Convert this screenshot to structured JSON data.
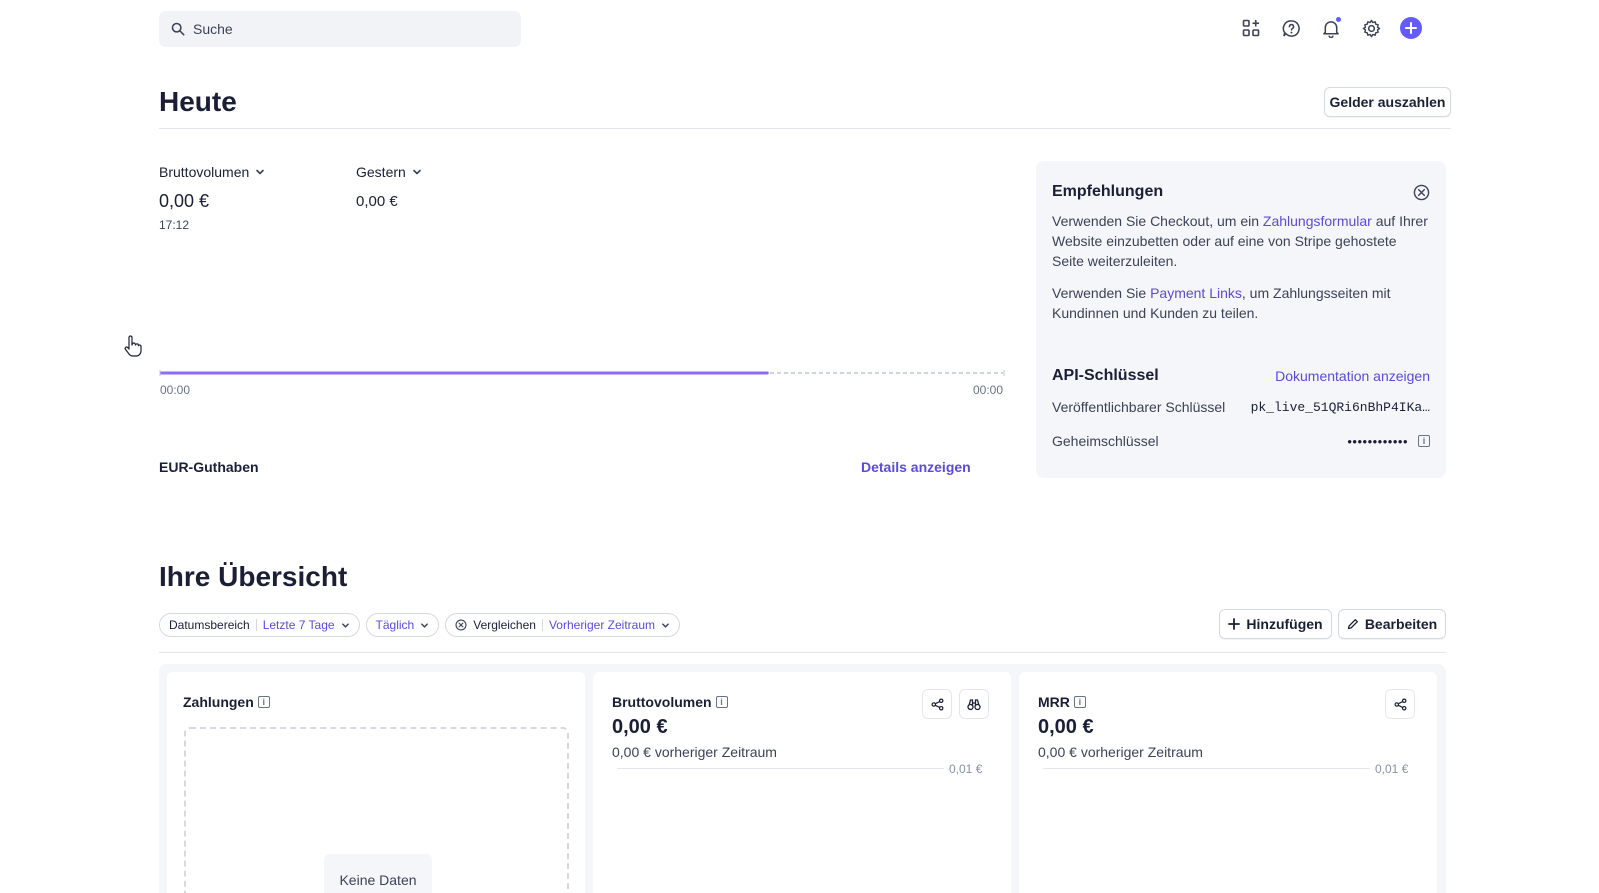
{
  "search": {
    "placeholder": "Suche"
  },
  "topbar": {
    "icons": [
      "apps-icon",
      "help-icon",
      "bell-icon",
      "gear-icon",
      "plus-icon"
    ]
  },
  "today": {
    "title": "Heute",
    "payout_button": "Gelder auszahlen",
    "gross_label": "Bruttovolumen",
    "gross_value": "0,00 €",
    "gross_time": "17:12",
    "compare_label": "Gestern",
    "compare_value": "0,00 €",
    "axis_start": "00:00",
    "axis_end": "00:00",
    "progress_fraction": 0.72,
    "balance_label": "EUR-Guthaben",
    "details_link": "Details anzeigen"
  },
  "recommendations": {
    "title": "Empfehlungen",
    "p1_before": "Verwenden Sie Checkout, um ein ",
    "p1_link": "Zahlungsformular",
    "p1_after": " auf Ihrer Website einzubetten oder auf eine von Stripe gehostete Seite weiterzuleiten.",
    "p2_before": "Verwenden Sie ",
    "p2_link": "Payment Links",
    "p2_after": ", um Zahlungsseiten mit Kundinnen und Kunden zu teilen."
  },
  "api": {
    "title": "API-Schlüssel",
    "docs_link": "Dokumentation anzeigen",
    "publishable_label": "Veröffentlichbarer Schlüssel",
    "publishable_value": "pk_live_51QRi6nBhP4IKa…",
    "secret_label": "Geheimschlüssel",
    "secret_value": "••••••••••••"
  },
  "overview": {
    "title": "Ihre Übersicht",
    "filter_range_label": "Datumsbereich",
    "filter_range_value": "Letzte 7 Tage",
    "filter_interval": "Täglich",
    "filter_compare_label": "Vergleichen",
    "filter_compare_value": "Vorheriger Zeitraum",
    "add_button": "Hinzufügen",
    "edit_button": "Bearbeiten"
  },
  "cards": {
    "payments": {
      "title": "Zahlungen",
      "empty": "Keine Daten"
    },
    "gross": {
      "title": "Bruttovolumen",
      "value": "0,00 €",
      "sub": "0,00 € vorheriger Zeitraum",
      "axis": "0,01 €"
    },
    "mrr": {
      "title": "MRR",
      "value": "0,00 €",
      "sub": "0,00 € vorheriger Zeitraum",
      "axis": "0,01 €"
    }
  },
  "colors": {
    "accent": "#635bff",
    "link": "#5a4bda",
    "panel_bg": "#f4f6f9"
  }
}
